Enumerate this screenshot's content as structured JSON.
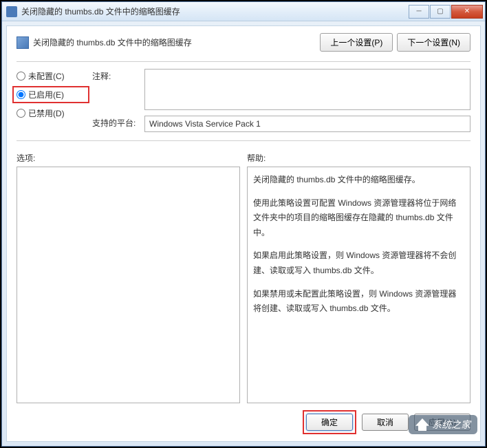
{
  "titlebar": {
    "text": "关闭隐藏的 thumbs.db 文件中的缩略图缓存"
  },
  "header": {
    "title": "关闭隐藏的 thumbs.db 文件中的缩略图缓存",
    "prev_button": "上一个设置(P)",
    "next_button": "下一个设置(N)"
  },
  "radios": {
    "not_configured": "未配置(C)",
    "enabled": "已启用(E)",
    "disabled": "已禁用(D)"
  },
  "fields": {
    "comment_label": "注释:",
    "comment_value": "",
    "platform_label": "支持的平台:",
    "platform_value": "Windows Vista Service Pack 1"
  },
  "panels": {
    "options_label": "选项:",
    "help_label": "帮助:",
    "help_p1": "关闭隐藏的 thumbs.db 文件中的缩略图缓存。",
    "help_p2": "使用此策略设置可配置 Windows 资源管理器将位于网络文件夹中的项目的缩略图缓存在隐藏的 thumbs.db 文件中。",
    "help_p3": "如果启用此策略设置，则 Windows 资源管理器将不会创建、读取或写入 thumbs.db 文件。",
    "help_p4": "如果禁用或未配置此策略设置，则 Windows 资源管理器将创建、读取或写入 thumbs.db 文件。"
  },
  "footer": {
    "ok": "确定",
    "cancel": "取消",
    "apply": "应用(A)"
  },
  "watermark": "系统之家"
}
